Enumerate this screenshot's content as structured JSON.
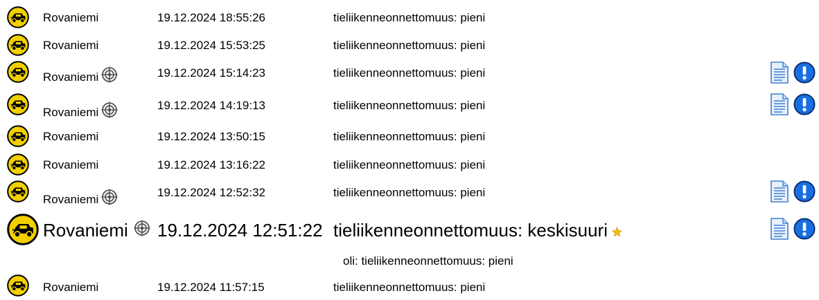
{
  "icons": {
    "vehicle": "car-accident-icon",
    "location": "target-icon",
    "document": "document-icon",
    "alert": "exclamation-icon",
    "new": "star-icon"
  },
  "colors": {
    "car_fill": "#f2d000",
    "alert_blue": "#1a6fe0",
    "doc_blue": "#3f7fd4",
    "star": "#f2c200"
  },
  "rows": [
    {
      "city": "Rovaniemi",
      "time": "19.12.2024 18:55:26",
      "type": "tieliikenneonnettomuus: pieni"
    },
    {
      "city": "Rovaniemi",
      "time": "19.12.2024 15:53:25",
      "type": "tieliikenneonnettomuus: pieni"
    },
    {
      "city": "Rovaniemi",
      "time": "19.12.2024 15:14:23",
      "type": "tieliikenneonnettomuus: pieni"
    },
    {
      "city": "Rovaniemi",
      "time": "19.12.2024 14:19:13",
      "type": "tieliikenneonnettomuus: pieni"
    },
    {
      "city": "Rovaniemi",
      "time": "19.12.2024 13:50:15",
      "type": "tieliikenneonnettomuus: pieni"
    },
    {
      "city": "Rovaniemi",
      "time": "19.12.2024 13:16:22",
      "type": "tieliikenneonnettomuus: pieni"
    },
    {
      "city": "Rovaniemi",
      "time": "19.12.2024 12:52:32",
      "type": "tieliikenneonnettomuus: pieni"
    },
    {
      "city": "Rovaniemi",
      "time": "19.12.2024 12:51:22",
      "type": "tieliikenneonnettomuus: keskisuuri",
      "previous": "oli: tieliikenneonnettomuus: pieni"
    },
    {
      "city": "Rovaniemi",
      "time": "19.12.2024 11:57:15",
      "type": "tieliikenneonnettomuus: pieni"
    }
  ]
}
